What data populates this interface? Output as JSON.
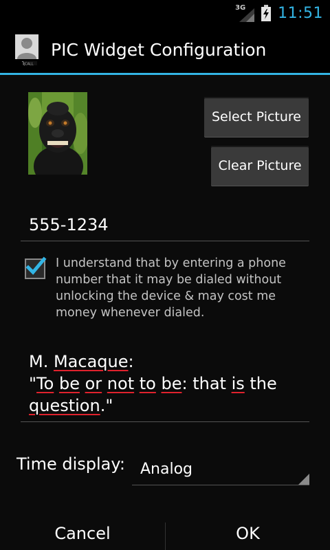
{
  "status_bar": {
    "network": "3G",
    "time": "11:51"
  },
  "app": {
    "title": "PIC Widget Configuration"
  },
  "picture": {
    "select_label": "Select Picture",
    "clear_label": "Clear Picture"
  },
  "phone": {
    "value": "555-1234"
  },
  "consent": {
    "checked": true,
    "text": "I understand that by entering a phone number that it may be dialed without unlocking the device & may cost me money whenever dialed."
  },
  "message": {
    "line1_pre": "M. ",
    "line1_word": "Macaque",
    "line1_post": ":",
    "words": [
      "\"",
      "To",
      " ",
      "be",
      " ",
      "or",
      " ",
      "not",
      " ",
      "to",
      " ",
      "be",
      ": that ",
      "is",
      " the ",
      "question",
      ".\""
    ]
  },
  "time_display": {
    "label": "Time display:",
    "value": "Analog"
  },
  "actions": {
    "cancel_label": "Cancel",
    "ok_label": "OK"
  },
  "colors": {
    "accent": "#33b5e5",
    "spellcheck": "#e0222d"
  }
}
